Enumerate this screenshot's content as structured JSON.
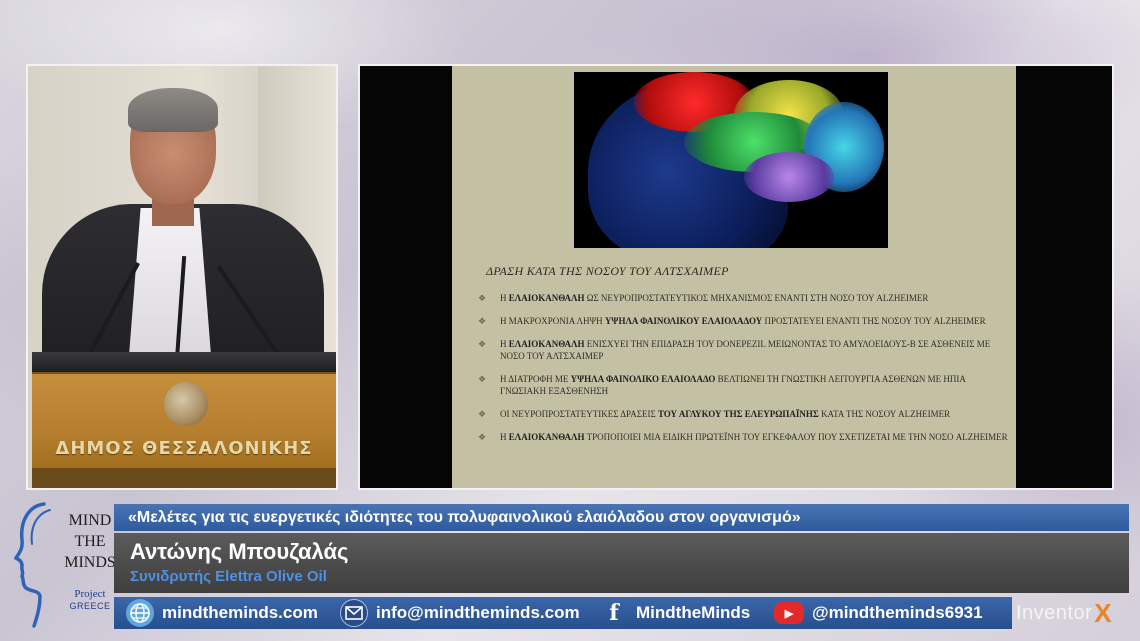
{
  "speaker_video": {
    "podium_text": "ΔΗΜΟΣ ΘΕΣΣΑΛΟΝΙΚΗΣ"
  },
  "slide": {
    "title": "ΔΡΑΣΗ ΚΑΤΑ ΤΗΣ ΝΟΣΟΥ ΤΟΥ ΑΛΤΣΧΑΙΜΕΡ",
    "bullet_symbol": "❖",
    "bullets": [
      {
        "lead": "Η",
        "bold": "ΕΛΑΙΟΚΑΝΘΑΛΗ",
        "rest": "ΩΣ ΝΕΥΡΟΠΡΟΣΤΑΤΕΥΤΙΚΟΣ ΜΗΧΑΝΙΣΜΟΣ ΕΝΑΝΤΙ ΣΤΗ ΝΟΣΟ ΤΟΥ ALZHEIMER"
      },
      {
        "lead": "Η ΜΑΚΡΟΧΡΟΝΙΑ ΛΗΨΗ",
        "bold": "ΥΨΗΛΑ ΦΑΙΝΟΛΙΚΟΥ ΕΛΑΙΟΛΑΔΟΥ",
        "rest": "ΠΡΟΣΤΑΤΕΥΕΙ ΕΝΑΝΤΙ ΤΗΣ ΝΟΣΟΥ ΤΟΥ ALZHEIMER"
      },
      {
        "lead": "Η",
        "bold": "ΕΛΑΙΟΚΑΝΘΑΛΗ",
        "rest": "ΕΝΙΣΧΥΕΙ ΤΗΝ ΕΠΙΔΡΑΣΗ ΤΟΥ DONEPEZIL ΜΕΙΩΝΟΝΤΑΣ ΤΟ ΑΜΥΛΟΕΙΔΟΥΣ-Β ΣΕ ΑΣΘΕΝΕΙΣ ΜΕ ΝΟΣΟ ΤΟΥ ΑΛΤΣΧΑΙΜΕΡ"
      },
      {
        "lead": "Η ΔΙΑΤΡΟΦΗ ΜΕ",
        "bold": "ΥΨΗΛΑ ΦΑΙΝΟΛΙΚΟ ΕΛΑΙΟΛΑΔΟ",
        "rest": "ΒΕΛΤΙΩΝΕΙ ΤΗ ΓΝΩΣΤΙΚΗ ΛΕΙΤΟΥΡΓΙΑ ΑΣΘΕΝΩΝ ΜΕ ΗΠΙΑ ΓΝΩΣΙΑΚΗ ΕΞΑΣΘΕΝΗΣΗ"
      },
      {
        "lead": "ΟΙ ΝΕΥΡΟΠΡΟΣΤΑΤΕΥΤΙΚΕΣ ΔΡΑΣΕΙΣ",
        "bold": "ΤΟΥ ΑΓΛΥΚΟΥ ΤΗΣ ΕΛΕΥΡΩΠΑΪΝΗΣ",
        "rest": "ΚΑΤΑ ΤΗΣ ΝΟΣΟΥ ALZHEIMER"
      },
      {
        "lead": "Η",
        "bold": "ΕΛΑΙΟΚΑΝΘΑΛΗ",
        "rest": "ΤΡΟΠΟΠΟΙΕΙ ΜΙΑ ΕΙΔΙΚΗ ΠΡΩΤΕΪΝΗ ΤΟΥ ΕΓΚΕΦΑΛΟΥ ΠΟΥ ΣΧΕΤΙΖΕΤΑΙ ΜΕ ΤΗΝ ΝΟΣΟ ALZHEIMER"
      }
    ]
  },
  "logo": {
    "line1": "MIND",
    "line2": "THE",
    "line3": "MINDS",
    "project": "Project",
    "country": "GREECE",
    "icon": "head-profile-icon"
  },
  "lower_third": {
    "topic": "«Μελέτες για τις ευεργετικές ιδιότητες του πολυφαινολικού ελαιόλαδου στον οργανισμό»",
    "speaker_name": "Αντώνης Μπουζαλάς",
    "speaker_role": "Συνιδρυτής Elettra Olive Oil"
  },
  "contacts": {
    "website": {
      "icon": "globe-icon",
      "text": "mindtheminds.com"
    },
    "email": {
      "icon": "mail-icon",
      "text": "info@mindtheminds.com"
    },
    "facebook": {
      "icon": "facebook-icon",
      "text": "MindtheMinds"
    },
    "youtube": {
      "icon": "youtube-icon",
      "text": "@mindtheminds6931"
    }
  },
  "sponsor": {
    "name": "Inventor",
    "mark": "X"
  },
  "colors": {
    "topic_bar": "#3b66a8",
    "speaker_bar": "#4a4a4a",
    "role_text": "#4f8fe6",
    "slide_bg": "#c4c0a4",
    "sponsor_accent": "#e8842a"
  }
}
